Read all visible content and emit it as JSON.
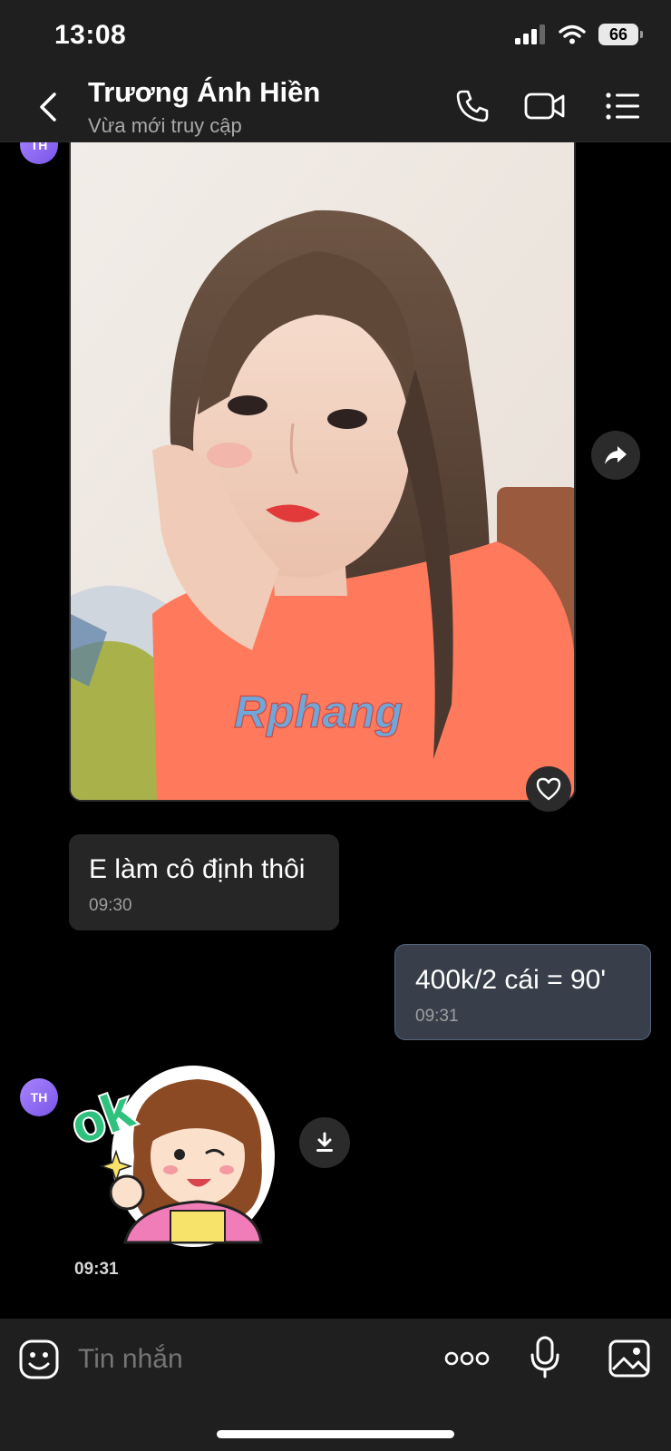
{
  "status": {
    "time": "13:08",
    "battery": "66",
    "icons": [
      "cellular-signal-icon",
      "wifi-icon",
      "battery-icon"
    ]
  },
  "header": {
    "name": "Trương Ánh Hiền",
    "status": "Vừa mới truy cập",
    "icons": [
      "back-icon",
      "phone-icon",
      "video-call-icon",
      "menu-list-icon"
    ]
  },
  "chat": {
    "avatar_initials": "TH",
    "photo": {
      "watermark": "Rphang",
      "actions": [
        "share-forward-icon",
        "heart-icon"
      ]
    },
    "messages": [
      {
        "direction": "received",
        "text": "E làm cô định thôi",
        "time": "09:30"
      },
      {
        "direction": "sent",
        "text": "400k/2 cái = 90'",
        "time": "09:31"
      }
    ],
    "sticker": {
      "text": "ok",
      "time": "09:31",
      "action": "download-icon"
    }
  },
  "composer": {
    "placeholder": "Tin nhắn",
    "icons": [
      "sticker-emoji-icon",
      "more-options-icon",
      "microphone-icon",
      "image-gallery-icon"
    ]
  },
  "colors": {
    "bar_background": "#1f1f1f",
    "chat_background": "#000000",
    "received_bubble": "#262626",
    "sent_bubble": "#383f4b",
    "avatar": "#8f6bf0"
  }
}
